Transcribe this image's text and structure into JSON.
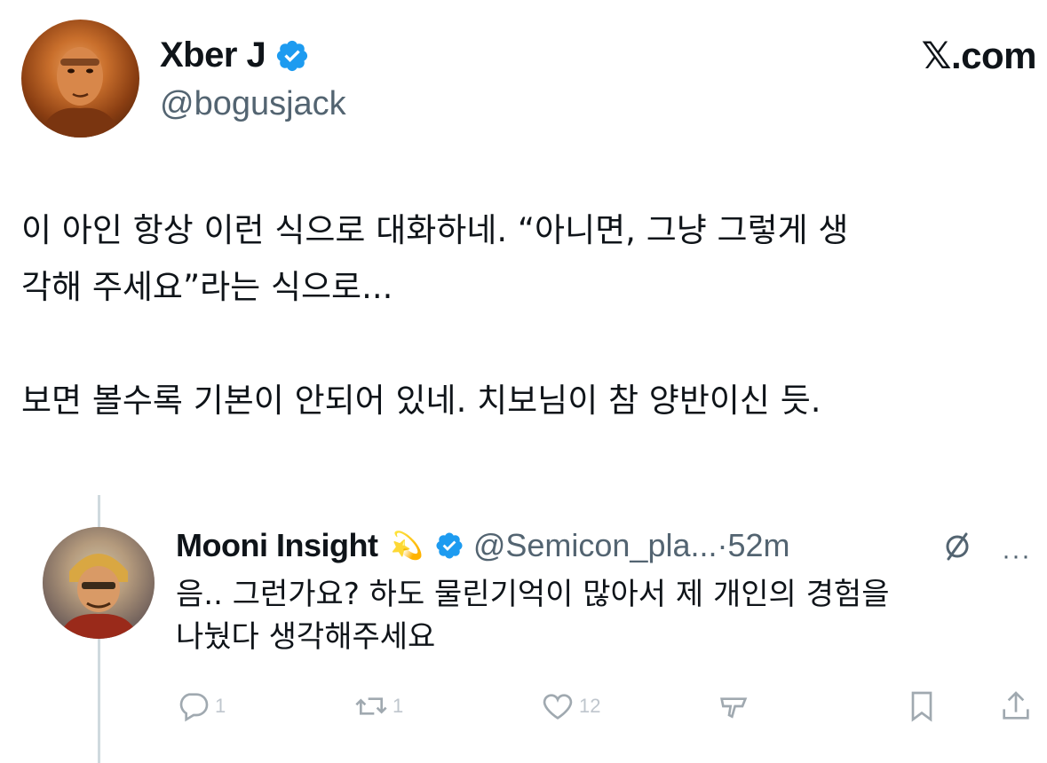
{
  "post": {
    "author_name": "Xber J",
    "author_handle": "@bogusjack",
    "site": "𝕏.com",
    "lines": [
      "이 아인 항상 이런 식으로 대화하네. “아니면, 그냥 그렇게 생",
      "각해 주세요”라는 식으로...",
      "보면 볼수록 기본이 안되어 있네. 치보님이 참 양반이신 듯."
    ]
  },
  "reply": {
    "name": "Mooni Insight",
    "emoji": "💫",
    "handle": "@Semicon_pla...",
    "separator": "·",
    "time": "52m",
    "more": "···",
    "lines": [
      "음.. 그런가요? 하도 물린기억이 많아서 제 개인의 경험을",
      "나눴다 생각해주세요"
    ],
    "actions": {
      "reply_count": "1",
      "repost_count": "1",
      "like_count": "12"
    }
  },
  "colors": {
    "verified_badge": "#1d9bf0",
    "secondary_text": "#536471",
    "thread_line": "#cfd9de"
  },
  "icons": [
    "verified-badge-icon",
    "grok-icon",
    "more-icon",
    "reply-icon",
    "repost-icon",
    "like-icon",
    "stats-icon",
    "bookmark-icon",
    "share-icon"
  ]
}
